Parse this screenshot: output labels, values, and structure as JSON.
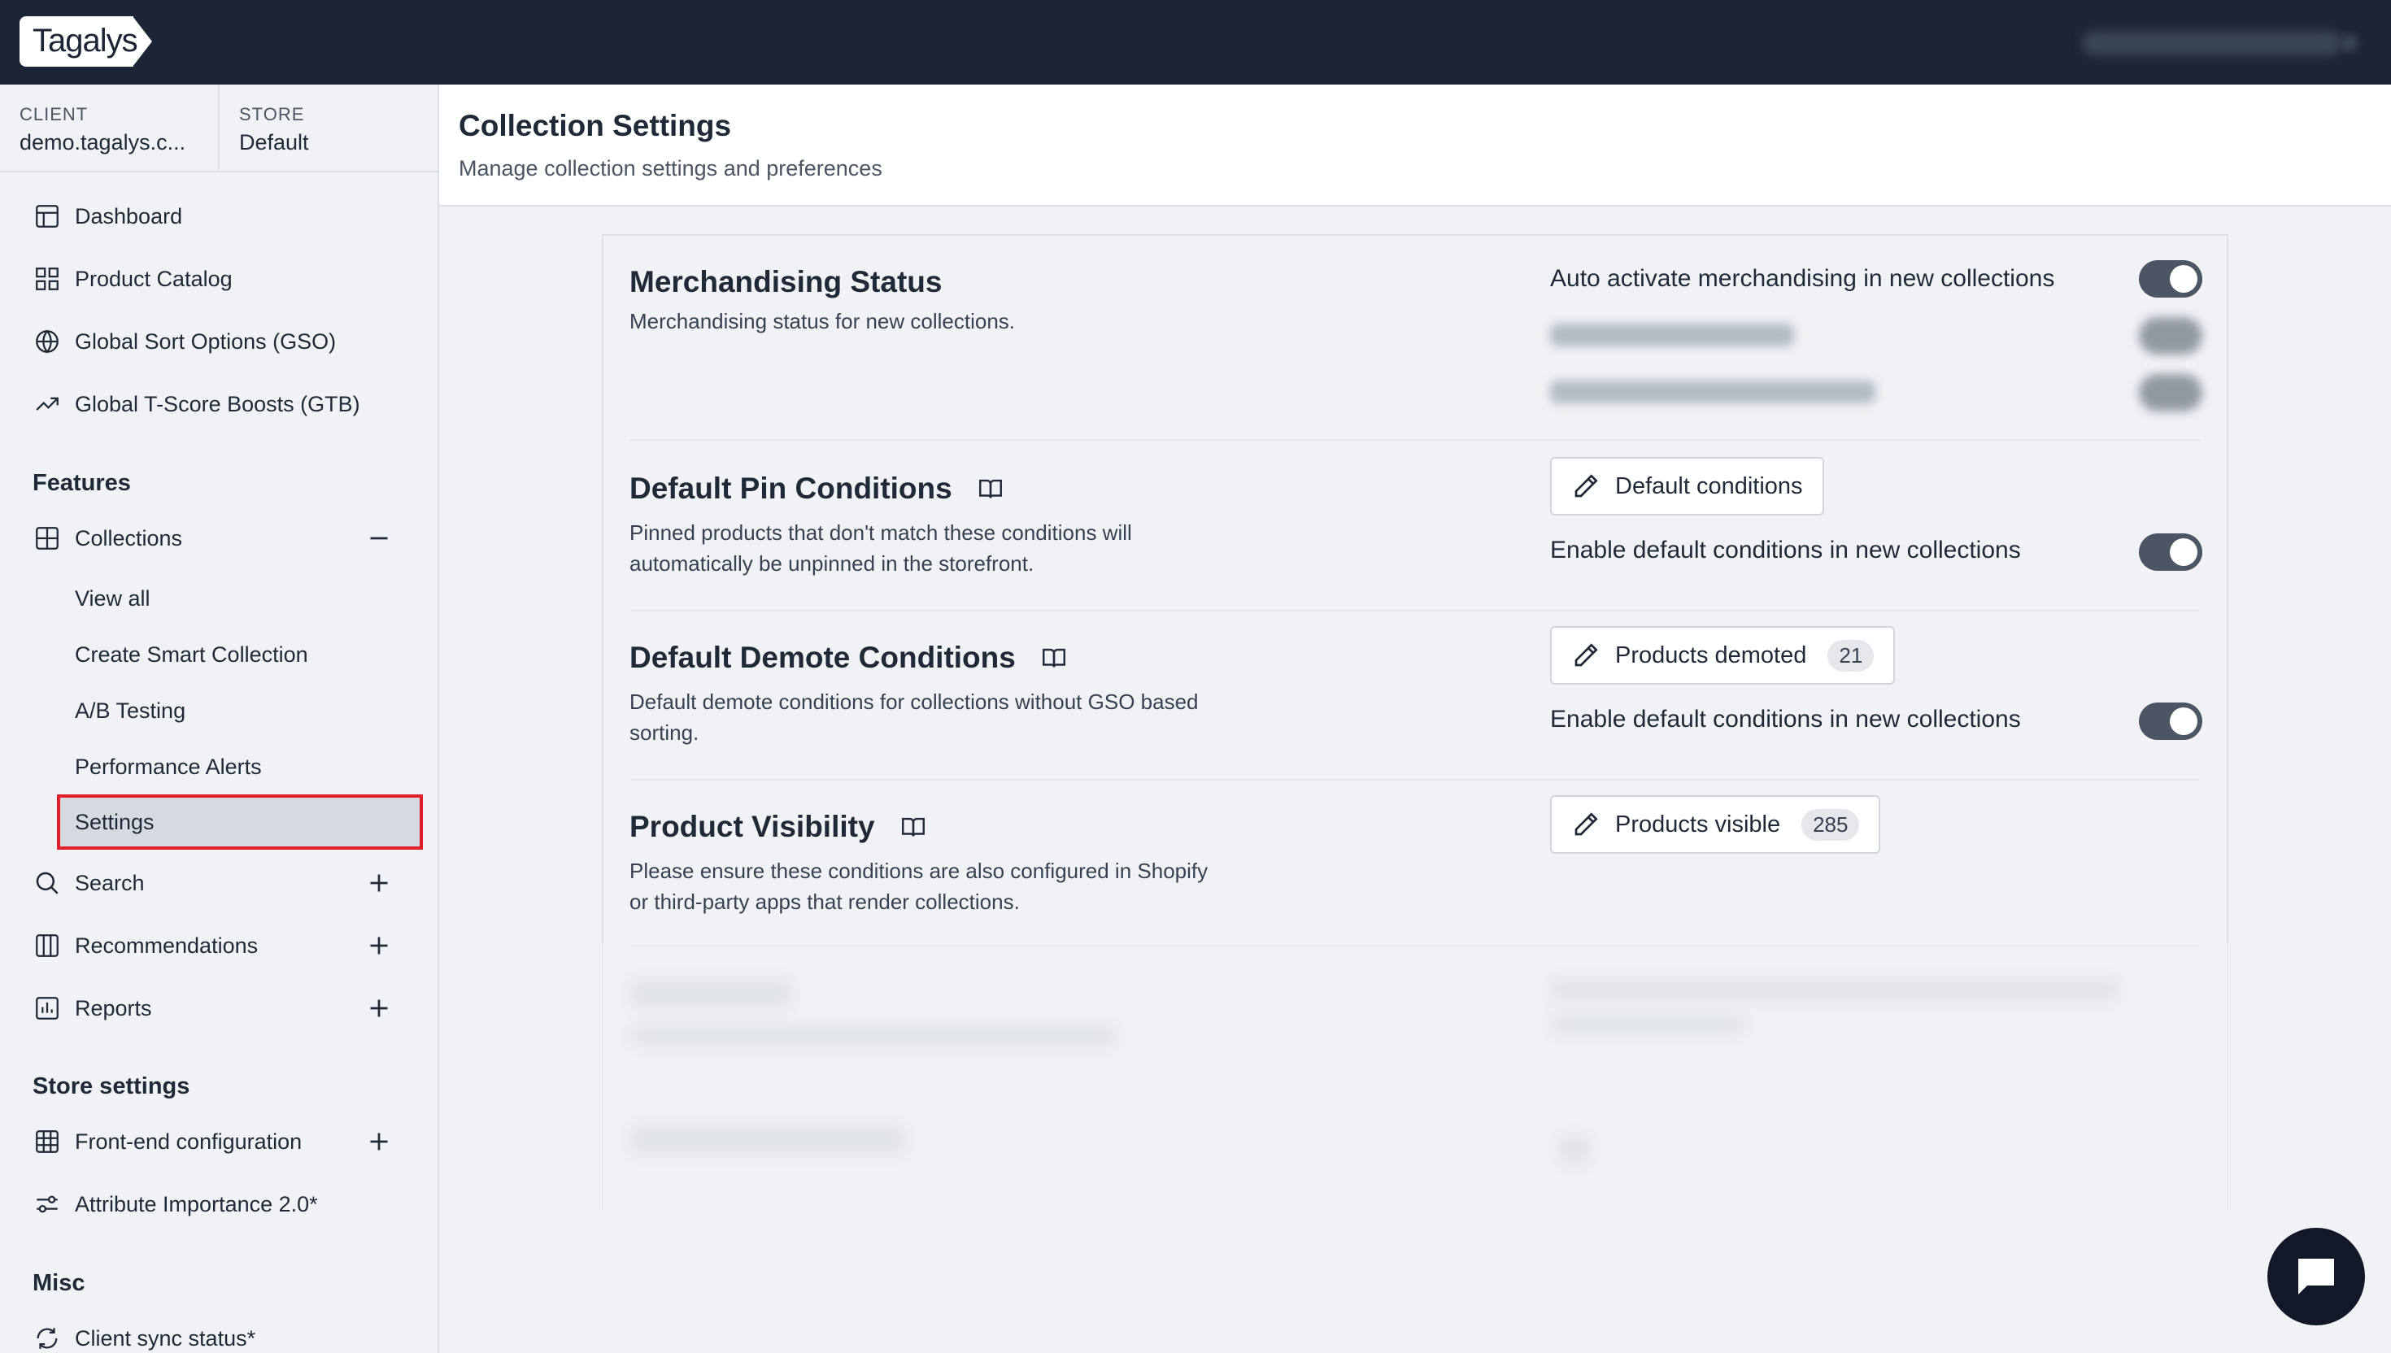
{
  "app": {
    "logo_text": "Tagalys"
  },
  "context": {
    "client_label": "CLIENT",
    "client_value": "demo.tagalys.c...",
    "store_label": "STORE",
    "store_value": "Default"
  },
  "nav": {
    "top_items": [
      {
        "label": "Dashboard",
        "icon": "layout-icon"
      },
      {
        "label": "Product Catalog",
        "icon": "grid-icon"
      },
      {
        "label": "Global Sort Options (GSO)",
        "icon": "globe-icon"
      },
      {
        "label": "Global T-Score Boosts (GTB)",
        "icon": "trending-up-icon"
      }
    ],
    "features_heading": "Features",
    "collections": {
      "label": "Collections",
      "sub_items": [
        "View all",
        "Create Smart Collection",
        "A/B Testing",
        "Performance Alerts",
        "Settings"
      ]
    },
    "search_label": "Search",
    "recommendations_label": "Recommendations",
    "reports_label": "Reports",
    "store_settings_heading": "Store settings",
    "frontend_label": "Front-end configuration",
    "attr_importance_label": "Attribute Importance 2.0*",
    "misc_heading": "Misc",
    "client_sync_label": "Client sync status*"
  },
  "header": {
    "title": "Collection Settings",
    "subtitle": "Manage collection settings and preferences"
  },
  "sections": {
    "merch": {
      "title": "Merchandising Status",
      "desc": "Merchandising status for new collections.",
      "option_label": "Auto activate merchandising in new collections",
      "option_on": true
    },
    "pin": {
      "title": "Default Pin Conditions",
      "desc": "Pinned products that don't match these conditions will automatically be unpinned in the storefront.",
      "button_label": "Default conditions",
      "option_label": "Enable default conditions in new collections",
      "option_on": true
    },
    "demote": {
      "title": "Default Demote Conditions",
      "desc": "Default demote conditions for collections without GSO based sorting.",
      "button_label": "Products demoted",
      "button_count": "21",
      "option_label": "Enable default conditions in new collections",
      "option_on": true
    },
    "visibility": {
      "title": "Product Visibility",
      "desc": "Please ensure these conditions are also configured in Shopify or third-party apps that render collections.",
      "button_label": "Products visible",
      "button_count": "285"
    }
  }
}
